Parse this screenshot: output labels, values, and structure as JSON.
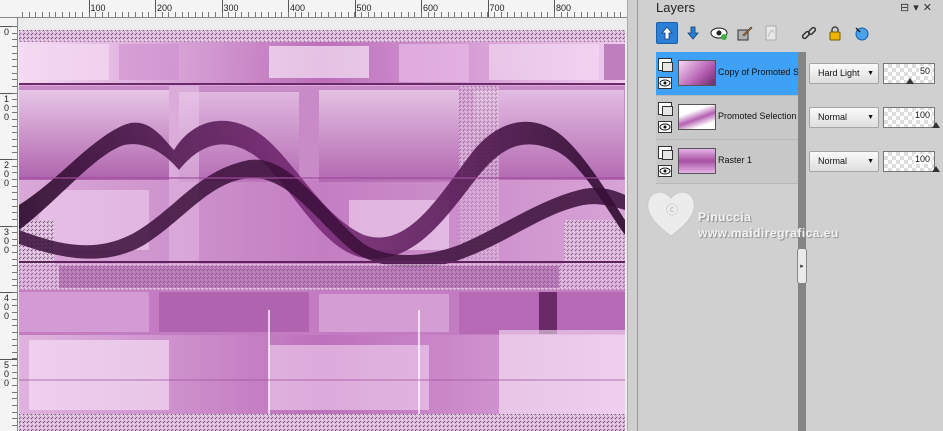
{
  "ruler": {
    "top_labels": [
      "100",
      "200",
      "300",
      "400",
      "500",
      "600",
      "700",
      "800"
    ],
    "left_labels": [
      {
        "digits": [
          "0"
        ]
      },
      {
        "digits": [
          "1",
          "0",
          "0"
        ]
      },
      {
        "digits": [
          "2",
          "0",
          "0"
        ]
      },
      {
        "digits": [
          "3",
          "0",
          "0"
        ]
      },
      {
        "digits": [
          "4",
          "0",
          "0"
        ]
      },
      {
        "digits": [
          "5",
          "0",
          "0"
        ]
      }
    ]
  },
  "panel": {
    "title": "Layers",
    "menu_icons": "pin-icon dropdown-icon close-icon",
    "toolbar_icons": [
      "move-layer-up-icon",
      "move-layer-down-icon",
      "visibility-icon",
      "edit-icon",
      "mask-icon",
      "link-icon",
      "lock-icon",
      "properties-icon"
    ]
  },
  "layers": [
    {
      "name": "Copy of Promoted Se",
      "blend_mode": "Hard Light",
      "opacity": "50",
      "selected": true
    },
    {
      "name": "Promoted Selection",
      "blend_mode": "Normal",
      "opacity": "100",
      "selected": false
    },
    {
      "name": "Raster 1",
      "blend_mode": "Normal",
      "opacity": "100",
      "selected": false
    }
  ],
  "watermark": {
    "name": "Pinuccia",
    "site": "www.maidiregrafica.eu"
  },
  "colors": {
    "accent_blue": "#3ea1f5",
    "canvas_purple_dark": "#8a3a88",
    "canvas_purple_light": "#f0cbef"
  }
}
